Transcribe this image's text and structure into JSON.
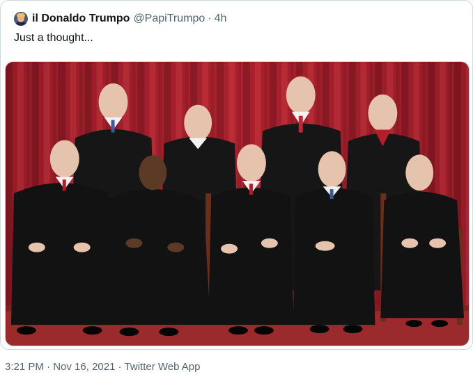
{
  "tweet": {
    "author": {
      "display_name": "il Donaldo Trumpo",
      "handle": "@PapiTrumpo",
      "avatar_icon": "profile-avatar"
    },
    "separator": "·",
    "relative_time": "4h",
    "text": "Just a thought...",
    "media": {
      "kind": "photo",
      "icon": "group-portrait-image"
    },
    "timestamp": {
      "time": "3:21 PM",
      "date": "Nov 16, 2021",
      "client": "Twitter Web App"
    }
  },
  "colors": {
    "text_primary": "#0f1419",
    "text_secondary": "#536471",
    "border": "#cfd9de",
    "curtain": "#a8202c",
    "carpet": "#9a2a2c",
    "robe": "#141414"
  }
}
